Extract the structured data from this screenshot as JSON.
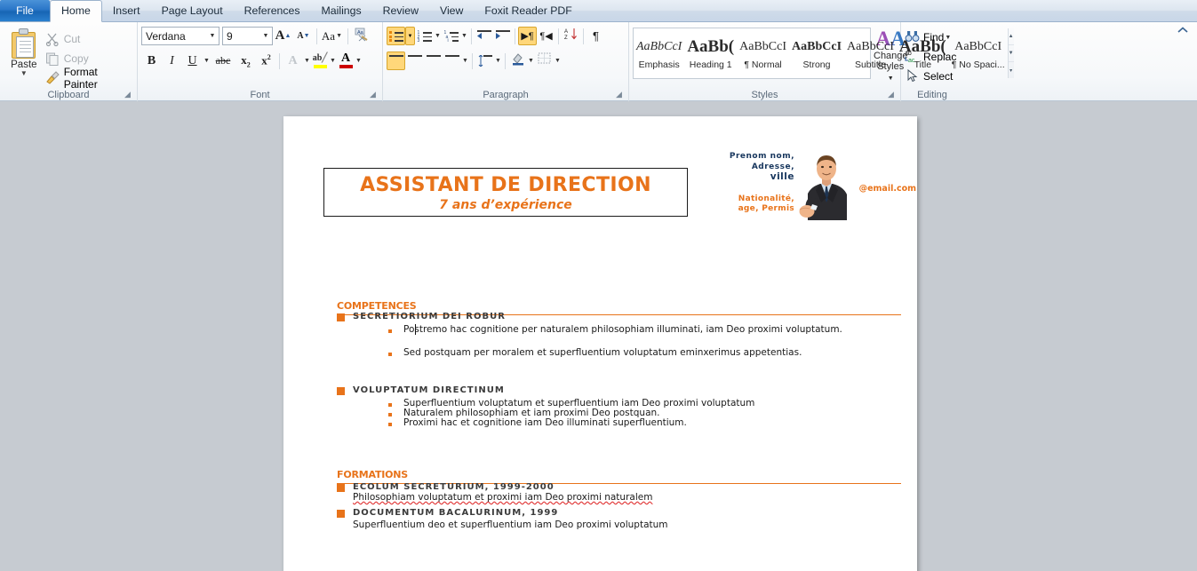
{
  "ribbon": {
    "tabs": [
      {
        "label": "File",
        "id": "file",
        "active": false
      },
      {
        "label": "Home",
        "id": "home",
        "active": true
      },
      {
        "label": "Insert",
        "id": "insert",
        "active": false
      },
      {
        "label": "Page Layout",
        "id": "page-layout",
        "active": false
      },
      {
        "label": "References",
        "id": "references",
        "active": false
      },
      {
        "label": "Mailings",
        "id": "mailings",
        "active": false
      },
      {
        "label": "Review",
        "id": "review",
        "active": false
      },
      {
        "label": "View",
        "id": "view",
        "active": false
      },
      {
        "label": "Foxit Reader PDF",
        "id": "foxit-reader-pdf",
        "active": false
      }
    ],
    "collapse_icon": "chevron-up-icon",
    "groups": {
      "clipboard": {
        "label": "Clipboard",
        "paste_label": "Paste",
        "cut_label": "Cut",
        "copy_label": "Copy",
        "format_painter_label": "Format Painter"
      },
      "font": {
        "label": "Font",
        "font_name": "Verdana",
        "font_size": "9",
        "bold": "B",
        "italic": "I",
        "underline": "U",
        "strikethrough": "abc",
        "subscript": "x",
        "superscript": "x",
        "grow_font": "A",
        "shrink_font": "A",
        "change_case": "Aa",
        "clear_formatting": "clear-formatting-icon",
        "text_effects": "A",
        "highlight": "ab",
        "font_color": "A",
        "font_color_swatch": "#cc0000",
        "highlight_swatch": "#ffff00"
      },
      "paragraph": {
        "label": "Paragraph",
        "bullets": "bullets-icon",
        "numbering": "numbering-icon",
        "multilevel_list": "multilevel-list-icon",
        "decrease_indent": "decrease-indent-icon",
        "increase_indent": "increase-indent-icon",
        "ltr_direction": "left-to-right-icon",
        "rtl_direction": "right-to-left-icon",
        "sort": "sort-az-icon",
        "show_marks": "pilcrow-icon",
        "align_left": "align-left-icon",
        "align_center": "align-center-icon",
        "align_right": "align-right-icon",
        "justify": "justify-icon",
        "line_spacing": "line-spacing-icon",
        "shading": "shading-icon",
        "borders": "borders-icon"
      },
      "styles": {
        "label": "Styles",
        "items": [
          {
            "preview": "AaBbCcI",
            "name": "Emphasis",
            "style": "italic-serif"
          },
          {
            "preview": "AaBb(",
            "name": "Heading 1",
            "style": "bold-large"
          },
          {
            "preview": "AaBbCcI",
            "name": "¶ Normal",
            "style": "plain"
          },
          {
            "preview": "AaBbCcI",
            "name": "Strong",
            "style": "bold"
          },
          {
            "preview": "AaBbCcI",
            "name": "Subtitle",
            "style": "plain"
          },
          {
            "preview": "AaBb(",
            "name": "Title",
            "style": "bold-large"
          },
          {
            "preview": "AaBbCcI",
            "name": "¶ No Spaci...",
            "style": "plain"
          }
        ],
        "change_styles_line1": "Change",
        "change_styles_line2": "Styles",
        "scroll_up": "scroll-up-icon",
        "scroll_down": "scroll-down-icon",
        "more": "more-styles-icon"
      },
      "editing": {
        "label": "Editing",
        "find_label": "Find",
        "replace_label": "Replac",
        "select_label": "Select"
      }
    }
  },
  "document": {
    "title": "ASSISTANT DE DIRECTION",
    "subtitle": "7 ans d’expérience",
    "contact": {
      "name": "Prenom nom,",
      "address": "Adresse,",
      "city": "ville",
      "details_line1": "Nationalité,",
      "details_line2": "age, Permis",
      "email": "mon@email.com"
    },
    "photo_alt": "portrait-photo",
    "sections": [
      {
        "heading": "COMPETENCES",
        "blocks": [
          {
            "subheading": "SECRETIORIUM DEI ROBUR",
            "bullets": [
              "Postremo hac cognitione per naturalem philosophiam illuminati, iam Deo proximi voluptatum.",
              "Sed postquam per moralem et superfluentium voluptatum eminxerimus appetentias."
            ]
          },
          {
            "subheading": "VOLUPTATUM DIRECTINUM",
            "bullets": [
              "Superfluentium voluptatum et superfluentium iam Deo proximi voluptatum",
              "Naturalem philosophiam et iam proximi Deo postquan.",
              "Proximi hac et cognitione iam Deo illuminati superfluentium."
            ]
          }
        ]
      },
      {
        "heading": "FORMATIONS",
        "blocks": [
          {
            "subheading": "ECOLUM SECRETURIUM, 1999-2000",
            "description": "Philosophiam voluptatum et proximi iam Deo proximi naturalem",
            "spellchecked": true
          },
          {
            "subheading": "DOCUMENTUM BACALURINUM, 1999",
            "description": "Superfluentium deo  et superfluentium iam Deo proximi voluptatum",
            "spellchecked": false
          }
        ]
      }
    ]
  },
  "colors": {
    "accent_orange": "#e8731a",
    "contact_navy": "#17365d",
    "file_tab_blue": "#1765b4",
    "canvas_gray": "#c6cbd1",
    "spelling_red": "#e03030",
    "grammar_green": "#1f9f3f"
  }
}
